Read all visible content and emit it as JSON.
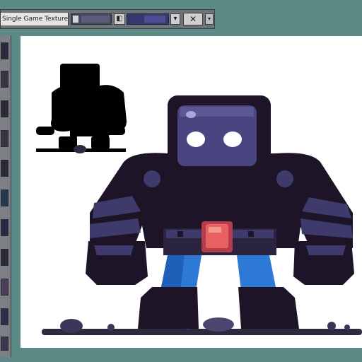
{
  "window": {
    "title": "Single Game Texture",
    "close_label": "✕",
    "menu_label": "▾",
    "ctrl_a_label": "◧",
    "ctrl_b_label": "▾"
  },
  "canvas": {
    "background": "#ffffff"
  },
  "colors": {
    "accent_teal": "#5b8a86",
    "robot_dark": "#1d1427",
    "robot_armor": "#3e3a6c",
    "robot_visor": "#4a4580",
    "belt_gem": "#e05a5a",
    "pants": "#2f79d6"
  }
}
